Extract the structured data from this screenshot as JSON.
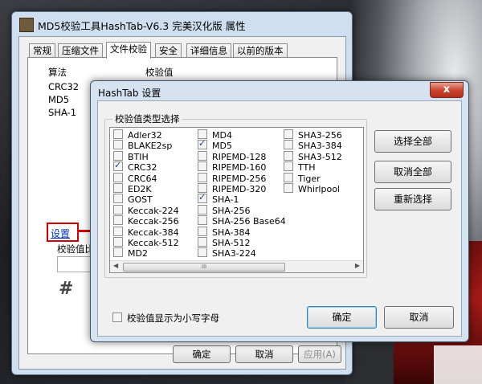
{
  "properties_window": {
    "title": "MD5校验工具HashTab-V6.3 完美汉化版 属性",
    "tabs": [
      "常规",
      "压缩文件",
      "文件校验",
      "安全",
      "详细信息",
      "以前的版本"
    ],
    "active_tab": "文件校验",
    "column_headers": {
      "algorithm": "算法",
      "checksum": "校验值"
    },
    "algorithms": [
      "CRC32",
      "MD5",
      "SHA-1"
    ],
    "settings_link": "设置",
    "compare_label": "校验值比较",
    "hash_icon": "#",
    "buttons": {
      "ok": "确定",
      "cancel": "取消",
      "apply": "应用(A)"
    }
  },
  "settings_dialog": {
    "title": "HashTab 设置",
    "close_glyph": "x",
    "group_label": "校验值类型选择",
    "columns": [
      [
        {
          "label": "Adler32",
          "checked": false
        },
        {
          "label": "BLAKE2sp",
          "checked": false
        },
        {
          "label": "BTIH",
          "checked": false
        },
        {
          "label": "CRC32",
          "checked": true
        },
        {
          "label": "CRC64",
          "checked": false
        },
        {
          "label": "ED2K",
          "checked": false
        },
        {
          "label": "GOST",
          "checked": false
        },
        {
          "label": "Keccak-224",
          "checked": false
        },
        {
          "label": "Keccak-256",
          "checked": false
        },
        {
          "label": "Keccak-384",
          "checked": false
        },
        {
          "label": "Keccak-512",
          "checked": false
        },
        {
          "label": "MD2",
          "checked": false
        }
      ],
      [
        {
          "label": "MD4",
          "checked": false
        },
        {
          "label": "MD5",
          "checked": true
        },
        {
          "label": "RIPEMD-128",
          "checked": false
        },
        {
          "label": "RIPEMD-160",
          "checked": false
        },
        {
          "label": "RIPEMD-256",
          "checked": false
        },
        {
          "label": "RIPEMD-320",
          "checked": false
        },
        {
          "label": "SHA-1",
          "checked": true
        },
        {
          "label": "SHA-256",
          "checked": false
        },
        {
          "label": "SHA-256 Base64",
          "checked": false
        },
        {
          "label": "SHA-384",
          "checked": false
        },
        {
          "label": "SHA-512",
          "checked": false
        },
        {
          "label": "SHA3-224",
          "checked": false
        }
      ],
      [
        {
          "label": "SHA3-256",
          "checked": false
        },
        {
          "label": "SHA3-384",
          "checked": false
        },
        {
          "label": "SHA3-512",
          "checked": false
        },
        {
          "label": "TTH",
          "checked": false
        },
        {
          "label": "Tiger",
          "checked": false
        },
        {
          "label": "Whirlpool",
          "checked": false
        }
      ]
    ],
    "scroll_thumb_grip": "III",
    "side_buttons": {
      "select_all": "选择全部",
      "deselect_all": "取消全部",
      "reselect": "重新选择"
    },
    "lowercase_option": {
      "label": "校验值显示为小写字母",
      "checked": false
    },
    "buttons": {
      "ok": "确定",
      "cancel": "取消"
    }
  },
  "colors": {
    "annotation_red": "#d40000",
    "link_blue": "#0033cc"
  }
}
